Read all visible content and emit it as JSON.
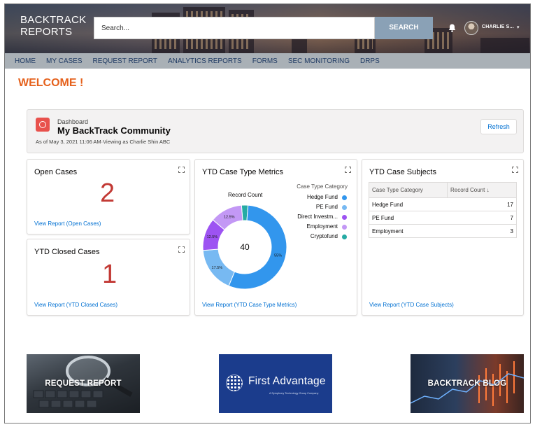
{
  "header": {
    "logo": "BACKTRACK\nREPORTS",
    "logo_line1": "BACKTRACK",
    "logo_line2": "REPORTS",
    "search_placeholder": "Search...",
    "search_button": "SEARCH",
    "user_name": "CHARLIE S...",
    "bell_icon": "bell-icon",
    "user_caret_icon": "caret-down-icon"
  },
  "nav": {
    "items": [
      "HOME",
      "MY CASES",
      "REQUEST REPORT",
      "ANALYTICS REPORTS",
      "FORMS",
      "SEC MONITORING",
      "DRPS"
    ]
  },
  "welcome": "WELCOME !",
  "dashboard": {
    "kicker": "Dashboard",
    "title": "My BackTrack Community",
    "subtitle": "As of May 3, 2021 11:06 AM·Viewing as Charlie Shin ABC",
    "refresh": "Refresh",
    "icon": "dashboard-gauge-icon"
  },
  "open_cases": {
    "title": "Open Cases",
    "value": "2",
    "link": "View Report (Open Cases)"
  },
  "closed_cases": {
    "title": "YTD Closed Cases",
    "value": "1",
    "link": "View Report (YTD Closed Cases)"
  },
  "case_type_metrics": {
    "title": "YTD Case Type Metrics",
    "record_count_label": "Record Count",
    "total": "40",
    "legend_title": "Case Type Category",
    "legend": [
      {
        "label": "Hedge Fund",
        "color": "#3296ed"
      },
      {
        "label": "PE Fund",
        "color": "#77b9f2"
      },
      {
        "label": "Direct Investm...",
        "color": "#9d53f2"
      },
      {
        "label": "Employment",
        "color": "#c398f5"
      },
      {
        "label": "Cryptofund",
        "color": "#26aba4"
      }
    ],
    "link": "View Report (YTD Case Type Metrics)"
  },
  "chart_data": {
    "type": "pie",
    "title": "YTD Case Type Metrics",
    "categories": [
      "Hedge Fund",
      "PE Fund",
      "Direct Investm...",
      "Employment",
      "Cryptofund"
    ],
    "values": [
      55,
      17.5,
      12.5,
      12.5,
      2.5
    ],
    "value_labels": [
      "55%",
      "17.5%",
      "12.5%",
      "12.5%",
      ""
    ],
    "total_label": "40",
    "measure": "Record Count",
    "legend_title": "Case Type Category",
    "legend_position": "right"
  },
  "case_subjects": {
    "title": "YTD Case Subjects",
    "columns": [
      "Case Type Category",
      "Record Count ↓"
    ],
    "rows": [
      [
        "Hedge Fund",
        "17"
      ],
      [
        "PE Fund",
        "7"
      ],
      [
        "Employment",
        "3"
      ]
    ],
    "link": "View Report (YTD Case Subjects)"
  },
  "tiles": [
    {
      "label": "REQUEST REPORT"
    },
    {
      "label": "First Advantage",
      "sub": "A Symphony Technology Group Company"
    },
    {
      "label": "BACKTRACK BLOG"
    }
  ]
}
